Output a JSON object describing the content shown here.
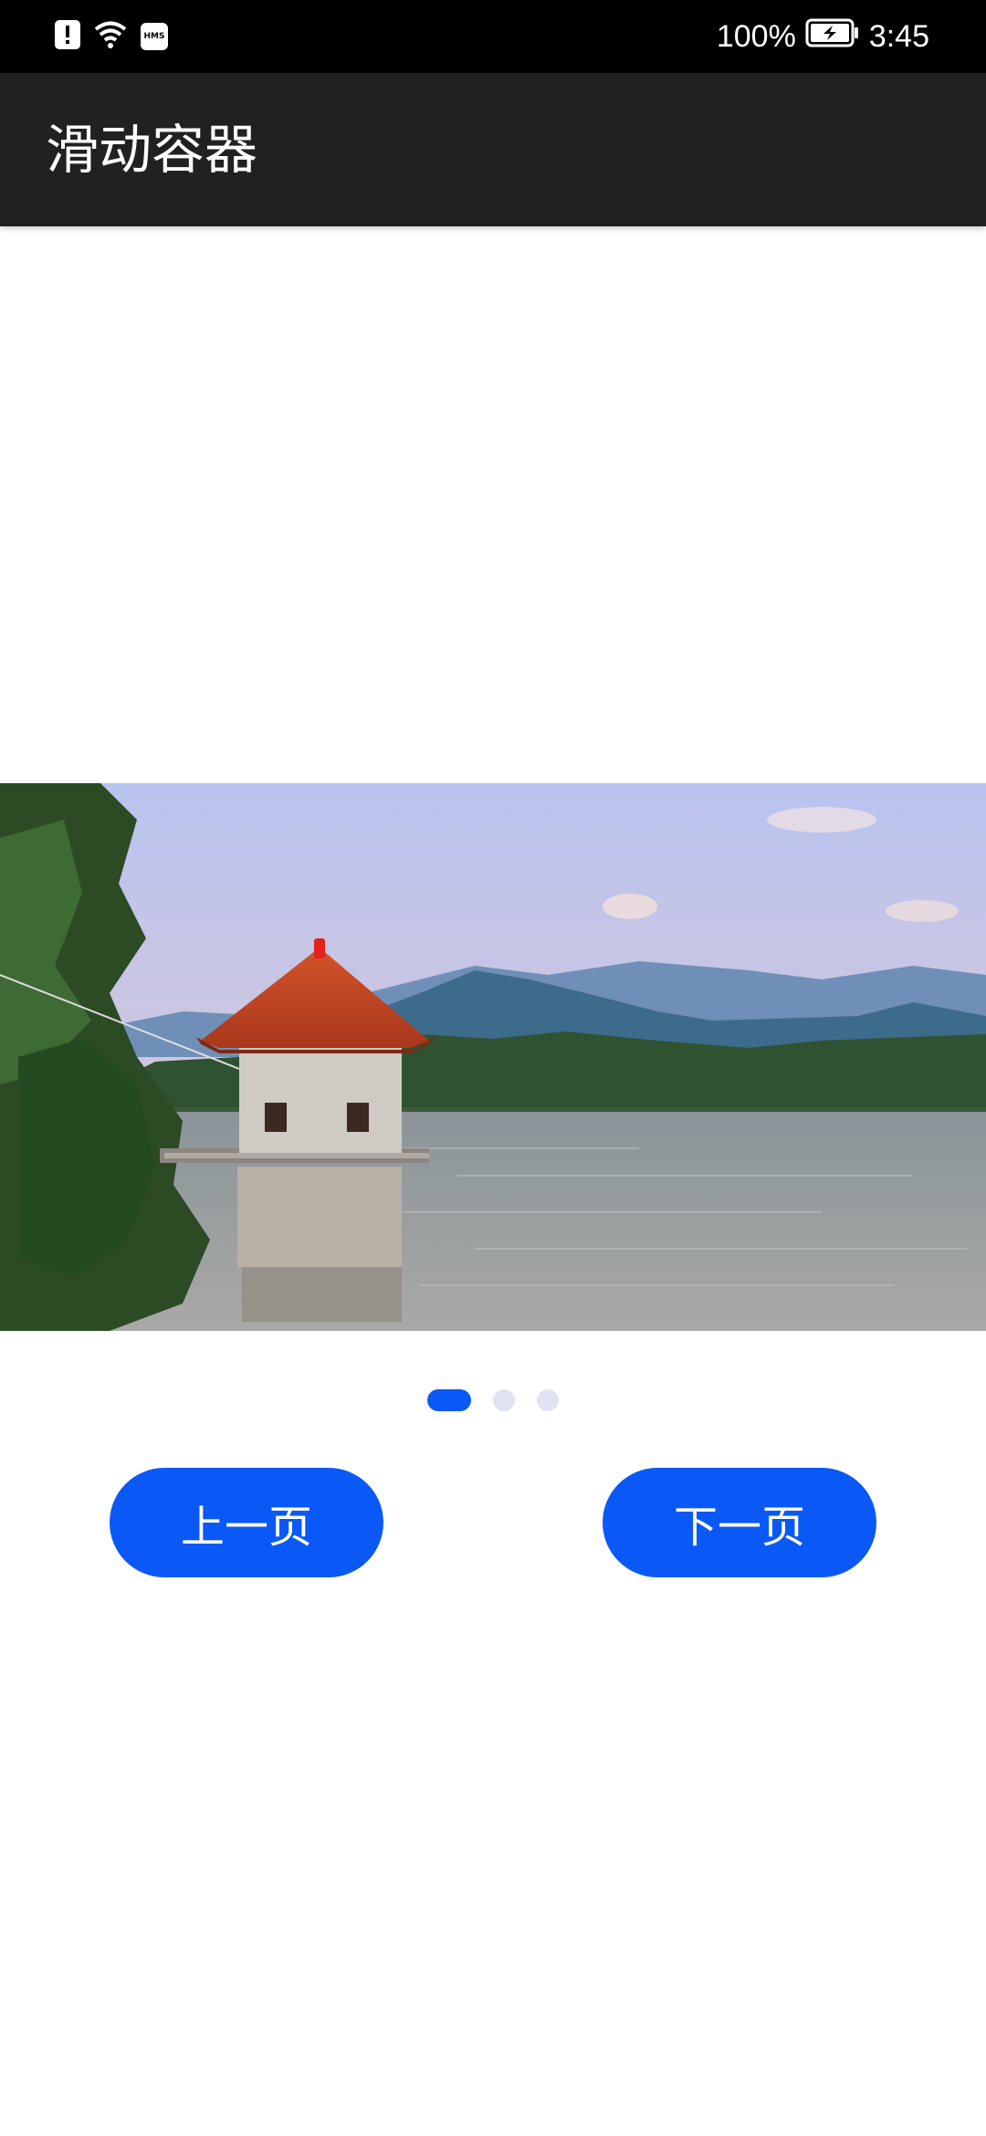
{
  "status_bar": {
    "battery_percent": "100%",
    "time": "3:45",
    "hms_label": "HMS",
    "icons": [
      "alert-icon",
      "wifi-icon",
      "hms-icon",
      "battery-charging-icon"
    ]
  },
  "app_bar": {
    "title": "滑动容器"
  },
  "carousel": {
    "current_index": 0,
    "total_pages": 3,
    "image": "lake-pavilion-landscape"
  },
  "buttons": {
    "prev_label": "上一页",
    "next_label": "下一页"
  },
  "colors": {
    "accent": "#0a59f7",
    "app_bar": "#212121",
    "dot_inactive": "#e1e3f3"
  }
}
